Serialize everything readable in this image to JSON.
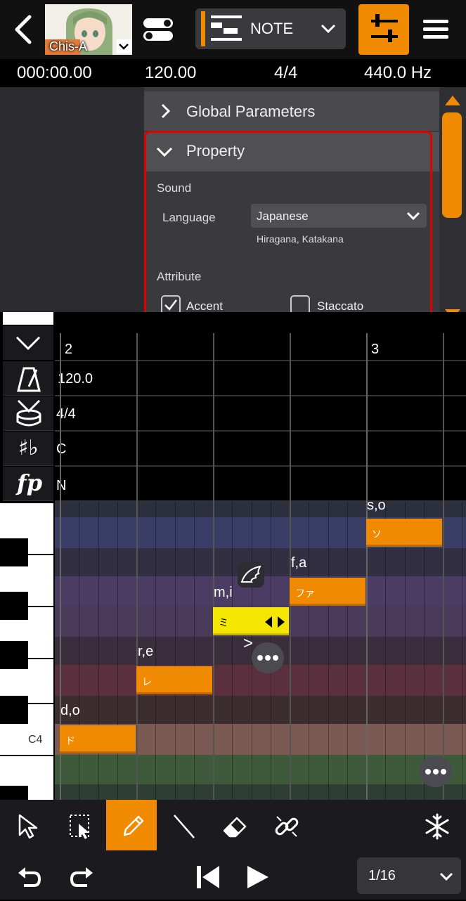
{
  "header": {
    "back_icon": "chevron-left-icon",
    "singer_name": "Chis-A",
    "mode_label": "NOTE",
    "toggle_icon": "toggle-icon",
    "properties_icon": "sliders-icon",
    "menu_icon": "hamburger-icon",
    "accent_color": "#f08a00"
  },
  "status": {
    "time": "000:00.00",
    "tempo": "120.00",
    "beat": "4/4",
    "pitch": "440.0 Hz"
  },
  "panel": {
    "global_params_label": "Global Parameters",
    "property_label": "Property",
    "sound_heading": "Sound",
    "language_label": "Language",
    "language_value": "Japanese",
    "language_hint": "Hiragana, Katakana",
    "attribute_heading": "Attribute",
    "accent_label": "Accent",
    "accent_checked": true,
    "staccato_label": "Staccato",
    "staccato_checked": false
  },
  "timeline": {
    "measure_2": "2",
    "measure_3": "3"
  },
  "tracks": {
    "tempo_value": "120.0",
    "beat_value": "4/4",
    "key_value": "C",
    "dynamics_value": "N"
  },
  "piano": {
    "c4_label": "C4"
  },
  "notes": [
    {
      "lyric": "s,o",
      "text": "ソ"
    },
    {
      "lyric": "f,a",
      "text": "ファ"
    },
    {
      "lyric": "m,i",
      "text": "ミ"
    },
    {
      "lyric": "r,e",
      "text": "レ"
    },
    {
      "lyric": "d,o",
      "text": "ド"
    }
  ],
  "marks": {
    "accent_mark": ">"
  },
  "toolbar": {
    "tools": [
      "arrow-select-icon",
      "range-select-icon",
      "pencil-icon",
      "line-icon",
      "eraser-icon",
      "link-icon",
      "snowflake-icon"
    ],
    "quantize_value": "1/16"
  }
}
